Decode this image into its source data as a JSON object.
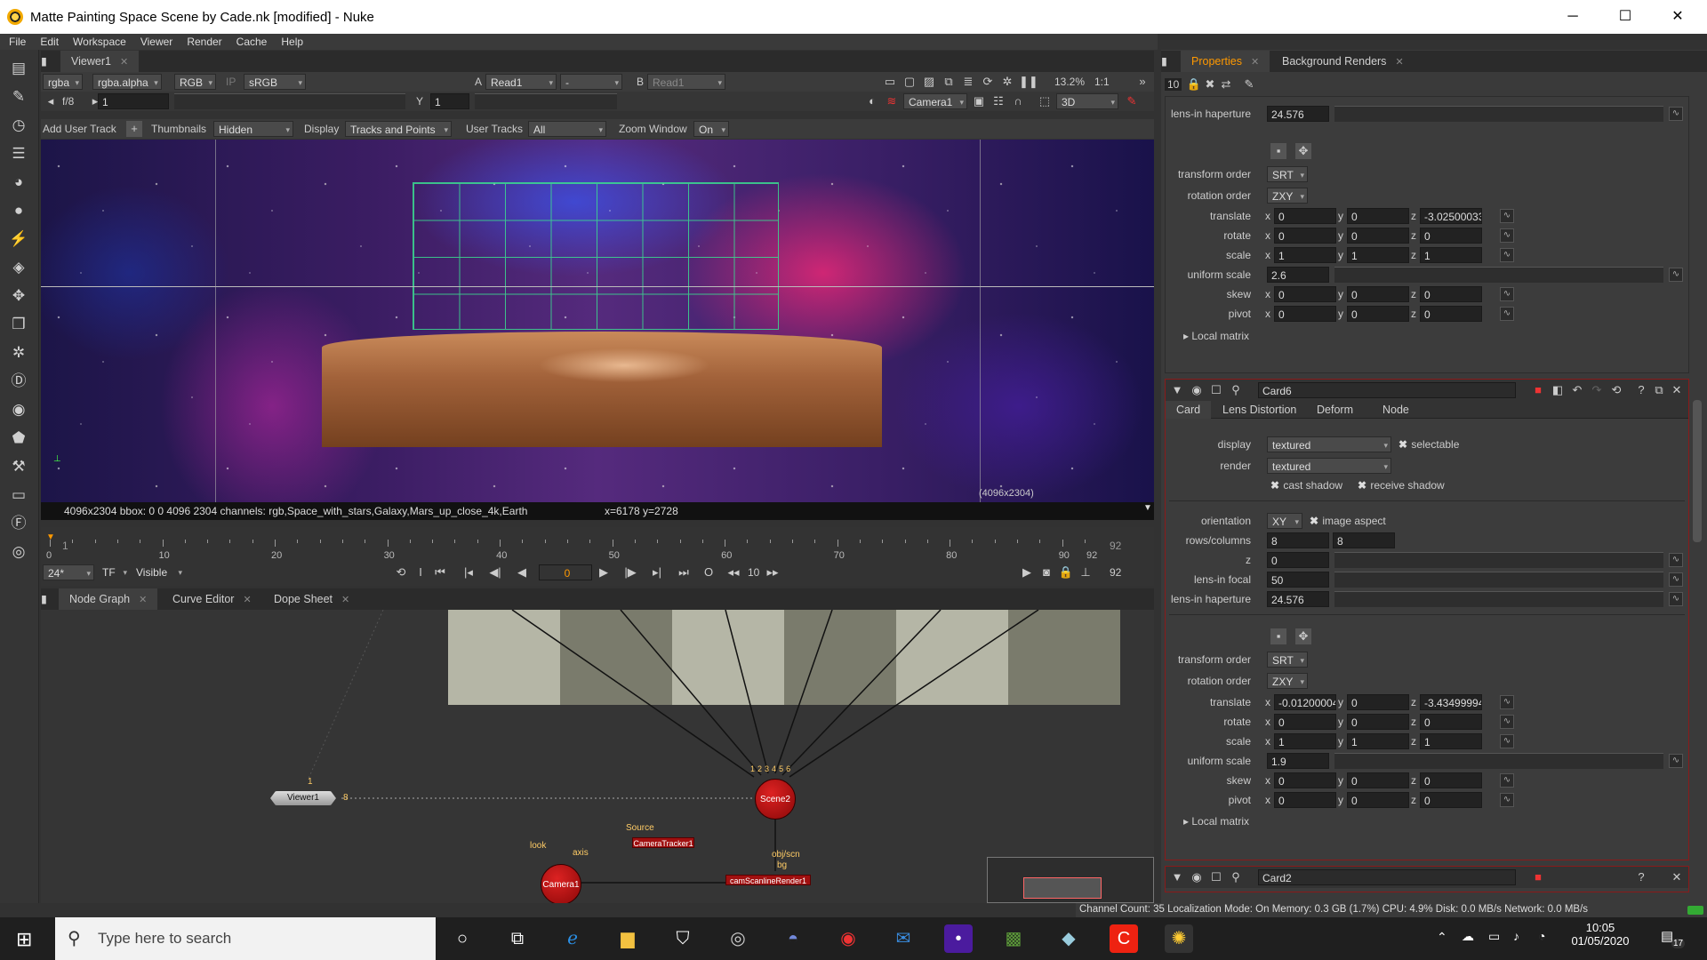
{
  "window": {
    "title": "Matte Painting Space Scene by Cade.nk [modified] - Nuke",
    "minimize": "─",
    "maximize": "☐",
    "close": "✕"
  },
  "menu": [
    "File",
    "Edit",
    "Workspace",
    "Viewer",
    "Render",
    "Cache",
    "Help"
  ],
  "viewer_tab": {
    "label": "Viewer1"
  },
  "viewer_bar1": {
    "channels": "rgba",
    "alpha": "rgba.alpha",
    "display": "RGB",
    "ip": "IP",
    "lut": "sRGB",
    "a_label": "A",
    "a_input": "Read1",
    "op": "-",
    "b_label": "B",
    "b_input": "Read1",
    "zoom": "13.2%",
    "ratio": "1:1"
  },
  "viewer_bar2": {
    "fstop": "f/8",
    "gain": "1",
    "y_label": "Y",
    "gamma": "1",
    "camera": "Camera1",
    "mode": "3D"
  },
  "viewer_bar3": {
    "add_user_track": "Add User Track",
    "thumbnails_label": "Thumbnails",
    "thumbnails": "Hidden",
    "display_label": "Display",
    "display": "Tracks and Points",
    "user_tracks_label": "User Tracks",
    "user_tracks": "All",
    "zoom_window_label": "Zoom Window",
    "zoom_window": "On"
  },
  "viewer_overlay": {
    "format_label": "(4096x2304)"
  },
  "viewer_info": {
    "text": "4096x2304  bbox: 0 0 4096 2304 channels: rgb,Space_with_stars,Galaxy,Mars_up_close_4k,Earth",
    "coords": "x=6178 y=2728"
  },
  "timeline": {
    "start": "1",
    "end": "92",
    "end_right": "92",
    "ticks": [
      "0",
      "10",
      "20",
      "30",
      "40",
      "50",
      "60",
      "70",
      "80",
      "90",
      "92"
    ],
    "fps": "24*",
    "tf": "TF",
    "visible": "Visible",
    "current_frame": "0",
    "step": "10",
    "last_frame": "92"
  },
  "graph_tabs": [
    {
      "label": "Node Graph"
    },
    {
      "label": "Curve Editor"
    },
    {
      "label": "Dope Sheet"
    }
  ],
  "nodes": {
    "viewer": "Viewer1",
    "scene": "Scene2",
    "camera": "Camera1",
    "tracker": "CameraTracker1",
    "render": "camScanlineRender1",
    "source": "Source",
    "look": "look",
    "axis": "axis",
    "objscn": "obj/scn",
    "bg": "bg",
    "viewer_in": "1",
    "viewer_out": "8",
    "scene_inputs": [
      "1",
      "2",
      "3",
      "4",
      "5",
      "6"
    ]
  },
  "props_tabs": [
    {
      "label": "Properties"
    },
    {
      "label": "Background Renders"
    }
  ],
  "props_header": {
    "count": "10"
  },
  "panel1": {
    "lens_haperture_label": "lens-in haperture",
    "lens_haperture": "24.576",
    "transform_order_label": "transform order",
    "transform_order": "SRT",
    "rotation_order_label": "rotation order",
    "rotation_order": "ZXY",
    "translate_label": "translate",
    "translate": [
      "0",
      "0",
      "-3.02500033"
    ],
    "rotate_label": "rotate",
    "rotate": [
      "0",
      "0",
      "0"
    ],
    "scale_label": "scale",
    "scale": [
      "1",
      "1",
      "1"
    ],
    "uniform_scale_label": "uniform scale",
    "uniform_scale": "2.6",
    "skew_label": "skew",
    "skew": [
      "0",
      "0",
      "0"
    ],
    "pivot_label": "pivot",
    "pivot": [
      "0",
      "0",
      "0"
    ],
    "local_matrix": "Local matrix"
  },
  "card6": {
    "name": "Card6",
    "tabs": [
      "Card",
      "Lens Distortion",
      "Deform",
      "Node"
    ],
    "display_label": "display",
    "display": "textured",
    "selectable": "selectable",
    "render_label": "render",
    "render": "textured",
    "cast_shadow": "cast shadow",
    "receive_shadow": "receive shadow",
    "orientation_label": "orientation",
    "orientation": "XY",
    "image_aspect": "image aspect",
    "rows_label": "rows/columns",
    "rows": "8",
    "cols": "8",
    "z_label": "z",
    "z": "0",
    "lens_focal_label": "lens-in focal",
    "lens_focal": "50",
    "lens_haperture_label": "lens-in haperture",
    "lens_haperture": "24.576",
    "transform_order_label": "transform order",
    "transform_order": "SRT",
    "rotation_order_label": "rotation order",
    "rotation_order": "ZXY",
    "translate_label": "translate",
    "translate": [
      "-0.01200004",
      "0",
      "-3.43499994"
    ],
    "rotate_label": "rotate",
    "rotate": [
      "0",
      "0",
      "0"
    ],
    "scale_label": "scale",
    "scale": [
      "1",
      "1",
      "1"
    ],
    "uniform_scale_label": "uniform scale",
    "uniform_scale": "1.9",
    "skew_label": "skew",
    "skew": [
      "0",
      "0",
      "0"
    ],
    "pivot_label": "pivot",
    "pivot": [
      "0",
      "0",
      "0"
    ],
    "local_matrix": "Local matrix"
  },
  "card2": {
    "name": "Card2"
  },
  "axis_letters": [
    "x",
    "y",
    "z"
  ],
  "status": "Channel Count: 35  Localization Mode: On  Memory: 0.3 GB (1.7%)  CPU: 4.9%  Disk: 0.0 MB/s  Network: 0.0 MB/s",
  "taskbar": {
    "search_placeholder": "Type here to search",
    "time": "10:05",
    "date": "01/05/2020",
    "notif": "17"
  }
}
